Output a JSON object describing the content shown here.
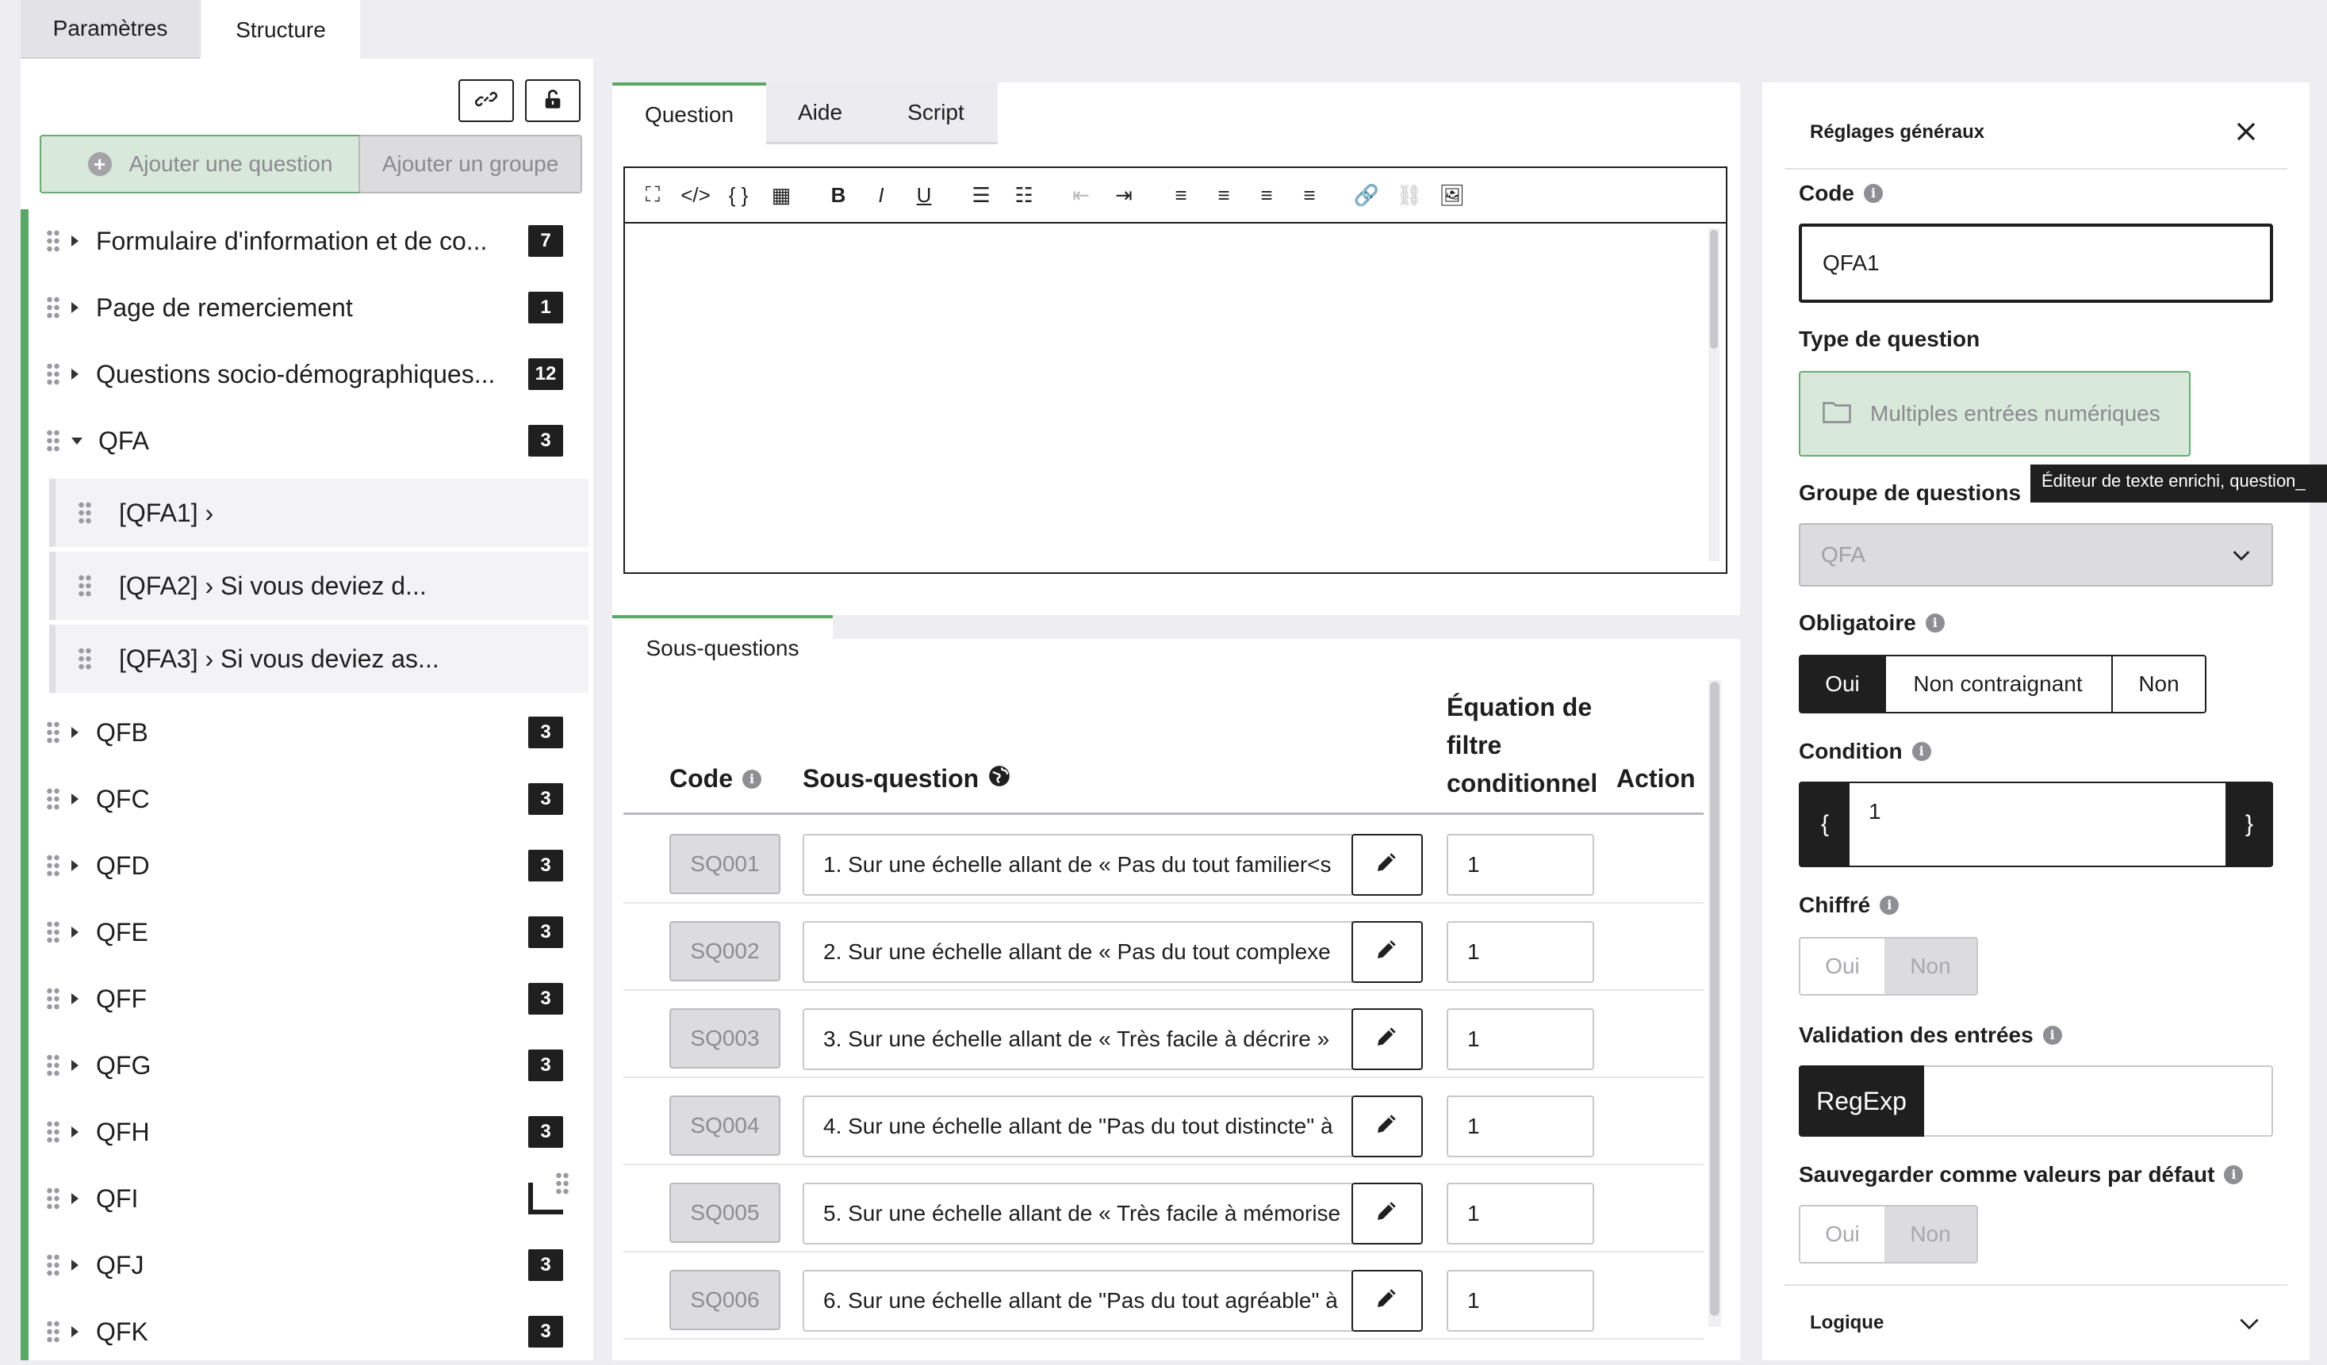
{
  "top_tabs": {
    "params": "Paramètres",
    "structure": "Structure"
  },
  "left": {
    "add_question": "Ajouter une question",
    "add_group": "Ajouter un groupe",
    "groups_top": [
      {
        "label": "Formulaire d'information et de co...",
        "count": "7"
      },
      {
        "label": "Page de remerciement",
        "count": "1"
      },
      {
        "label": "Questions socio-démographiques...",
        "count": "12"
      },
      {
        "label": "QFA",
        "count": "3"
      }
    ],
    "sub_items": [
      {
        "label": "[QFA1] ›"
      },
      {
        "label": "[QFA2] › Si vous deviez d..."
      },
      {
        "label": "[QFA3] › Si vous deviez as..."
      }
    ],
    "groups_bottom": [
      {
        "label": "QFB",
        "count": "3"
      },
      {
        "label": "QFC",
        "count": "3"
      },
      {
        "label": "QFD",
        "count": "3"
      },
      {
        "label": "QFE",
        "count": "3"
      },
      {
        "label": "QFF",
        "count": "3"
      },
      {
        "label": "QFG",
        "count": "3"
      },
      {
        "label": "QFH",
        "count": "3"
      },
      {
        "label": "QFI",
        "count": ""
      },
      {
        "label": "QFJ",
        "count": "3"
      },
      {
        "label": "QFK",
        "count": "3"
      }
    ]
  },
  "editor": {
    "tabs": {
      "question": "Question",
      "aide": "Aide",
      "script": "Script"
    },
    "toolbar": [
      "⛶",
      "</>",
      "{ }",
      "▦",
      "B",
      "I",
      "U",
      "☰",
      "☷",
      "⇤",
      "⇥",
      "≡",
      "≡",
      "≡",
      "≡",
      "🔗",
      "⛓",
      "🖼"
    ]
  },
  "subquestions": {
    "tab": "Sous-questions",
    "headers": {
      "code": "Code",
      "subq": "Sous-question",
      "eq": "Équation de filtre conditionnel",
      "action": "Action"
    },
    "rows": [
      {
        "code": "SQ001",
        "text": "1. Sur une échelle allant de « Pas du tout familier<s",
        "eq": "1"
      },
      {
        "code": "SQ002",
        "text": "2. Sur une échelle allant de « Pas du tout complexe",
        "eq": "1"
      },
      {
        "code": "SQ003",
        "text": "3. Sur une échelle allant de « Très facile à décrire »",
        "eq": "1"
      },
      {
        "code": "SQ004",
        "text": "4. Sur une échelle allant de \"Pas du tout distincte\" à",
        "eq": "1"
      },
      {
        "code": "SQ005",
        "text": "5. Sur une échelle allant de « Très facile à mémorise",
        "eq": "1"
      },
      {
        "code": "SQ006",
        "text": "6. Sur une échelle allant de \"Pas du tout agréable\" à",
        "eq": "1"
      }
    ]
  },
  "settings": {
    "title": "Réglages généraux",
    "code_label": "Code",
    "code_value": "QFA1",
    "type_label": "Type de question",
    "type_value": "Multiples entrées numériques",
    "tooltip": "Éditeur de texte enrichi, question_",
    "group_label": "Groupe de questions",
    "group_value": "QFA",
    "mandatory_label": "Obligatoire",
    "mandatory_options": [
      "Oui",
      "Non contraignant",
      "Non"
    ],
    "condition_label": "Condition",
    "condition_open": "{",
    "condition_close": "}",
    "condition_value": "1",
    "encrypted_label": "Chiffré",
    "encrypted_options": [
      "Oui",
      "Non"
    ],
    "validation_label": "Validation des entrées",
    "regexp_label": "RegExp",
    "save_default_label": "Sauvegarder comme valeurs par défaut",
    "save_default_options": [
      "Oui",
      "Non"
    ],
    "logic_label": "Logique"
  }
}
